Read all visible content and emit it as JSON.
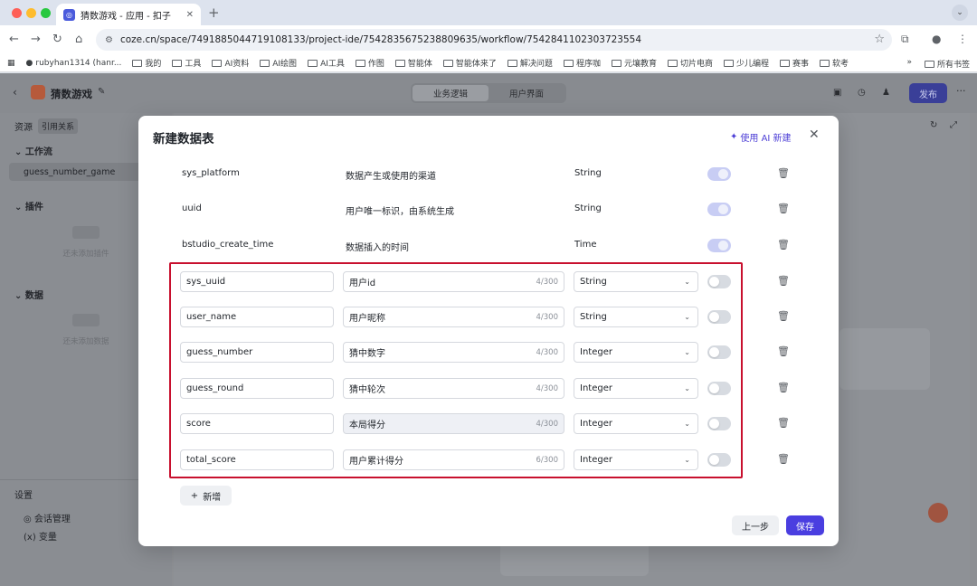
{
  "browser": {
    "tab_title": "猜数游戏 - 应用 - 扣子",
    "url": "coze.cn/space/7491885044719108133/project-ide/7542835675238809635/workflow/7542841102303723554",
    "bookmarks": [
      "rubyhan1314 (hanr...",
      "我的",
      "工具",
      "AI资料",
      "AI绘图",
      "AI工具",
      "作图",
      "智能体",
      "智能体来了",
      "解决问题",
      "程序咖",
      "元壤教育",
      "切片电商",
      "少儿编程",
      "赛事",
      "软考"
    ],
    "bookmarks_more": "»",
    "all_bookmarks": "所有书签"
  },
  "app": {
    "name": "猜数游戏",
    "mode_tabs": [
      "业务逻辑",
      "用户界面"
    ],
    "publish_label": "发布",
    "sidebar": {
      "resources": "资源",
      "references": "引用关系",
      "workflow_section": "工作流",
      "workflow_item": "guess_number_game",
      "plugin_section": "插件",
      "plugin_empty": "还未添加插件",
      "data_section": "数据",
      "data_empty": "还未添加数据",
      "settings": "设置",
      "session_mgmt": "会话管理",
      "variables": "变量"
    }
  },
  "modal": {
    "title": "新建数据表",
    "ai_create_label": "使用 AI 新建",
    "system_fields": [
      {
        "name": "sys_platform",
        "desc": "数据产生或使用的渠道",
        "type": "String"
      },
      {
        "name": "uuid",
        "desc": "用户唯一标识，由系统生成",
        "type": "String"
      },
      {
        "name": "bstudio_create_time",
        "desc": "数据插入的时间",
        "type": "Time"
      }
    ],
    "user_fields": [
      {
        "name": "sys_uuid",
        "desc": "用户id",
        "count": "4/300",
        "type": "String"
      },
      {
        "name": "user_name",
        "desc": "用户昵称",
        "count": "4/300",
        "type": "String"
      },
      {
        "name": "guess_number",
        "desc": "猜中数字",
        "count": "4/300",
        "type": "Integer"
      },
      {
        "name": "guess_round",
        "desc": "猜中轮次",
        "count": "4/300",
        "type": "Integer"
      },
      {
        "name": "score",
        "desc": "本局得分",
        "count": "4/300",
        "type": "Integer"
      },
      {
        "name": "total_score",
        "desc": "用户累计得分",
        "count": "6/300",
        "type": "Integer"
      }
    ],
    "add_label": "新增",
    "prev_label": "上一步",
    "save_label": "保存"
  },
  "colors": {
    "accent": "#4a3ee0",
    "highlight_border": "#c8102e"
  }
}
